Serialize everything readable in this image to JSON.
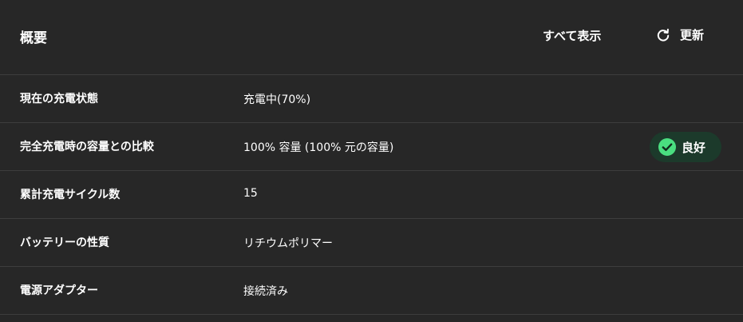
{
  "header": {
    "title": "概要",
    "show_all_label": "すべて表示",
    "refresh_label": "更新"
  },
  "rows": [
    {
      "label": "現在の充電状態",
      "value": "充電中(70%)"
    },
    {
      "label": "完全充電時の容量との比較",
      "value": "100% 容量 (100% 元の容量)",
      "badge": "良好"
    },
    {
      "label": "累計充電サイクル数",
      "value": "15"
    },
    {
      "label": "バッテリーの性質",
      "value": "リチウムポリマー"
    },
    {
      "label": "電源アダプター",
      "value": "接続済み"
    }
  ],
  "icons": {
    "refresh": "refresh-icon",
    "badge": "check-circle-icon"
  },
  "colors": {
    "background": "#272727",
    "divider": "#3d3d3d",
    "badge_background": "#1c3a2b",
    "badge_check": "#4ade80"
  }
}
